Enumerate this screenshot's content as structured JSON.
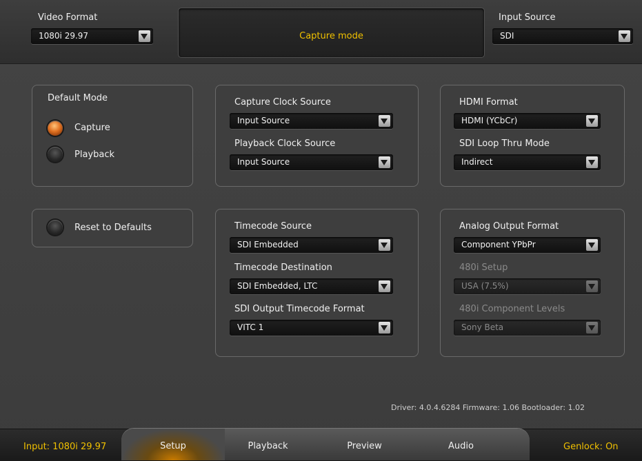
{
  "header": {
    "video_format": {
      "label": "Video Format",
      "value": "1080i 29.97"
    },
    "mode_text": "Capture mode",
    "input_source": {
      "label": "Input Source",
      "value": "SDI"
    }
  },
  "default_mode": {
    "title": "Default Mode",
    "options": [
      {
        "label": "Capture",
        "selected": true
      },
      {
        "label": "Playback",
        "selected": false
      }
    ]
  },
  "reset": {
    "label": "Reset to Defaults"
  },
  "clock": {
    "capture_label": "Capture Clock Source",
    "capture_value": "Input Source",
    "playback_label": "Playback Clock Source",
    "playback_value": "Input Source"
  },
  "hdmi": {
    "format_label": "HDMI Format",
    "format_value": "HDMI (YCbCr)",
    "loop_label": "SDI Loop Thru Mode",
    "loop_value": "Indirect"
  },
  "timecode": {
    "source_label": "Timecode Source",
    "source_value": "SDI Embedded",
    "dest_label": "Timecode Destination",
    "dest_value": "SDI Embedded, LTC",
    "format_label": "SDI Output Timecode Format",
    "format_value": "VITC 1"
  },
  "analog": {
    "format_label": "Analog Output Format",
    "format_value": "Component YPbPr",
    "setup_label": "480i Setup",
    "setup_value": "USA (7.5%)",
    "levels_label": "480i Component Levels",
    "levels_value": "Sony Beta"
  },
  "version_text": "Driver: 4.0.4.6284  Firmware: 1.06  Bootloader: 1.02",
  "footer": {
    "input_status": "Input: 1080i 29.97",
    "genlock_status": "Genlock: On",
    "tabs": [
      {
        "label": "Setup",
        "active": true
      },
      {
        "label": "Playback",
        "active": false
      },
      {
        "label": "Preview",
        "active": false
      },
      {
        "label": "Audio",
        "active": false
      }
    ]
  },
  "colors": {
    "accent": "#f0c000",
    "radio_on": "#e07020"
  }
}
